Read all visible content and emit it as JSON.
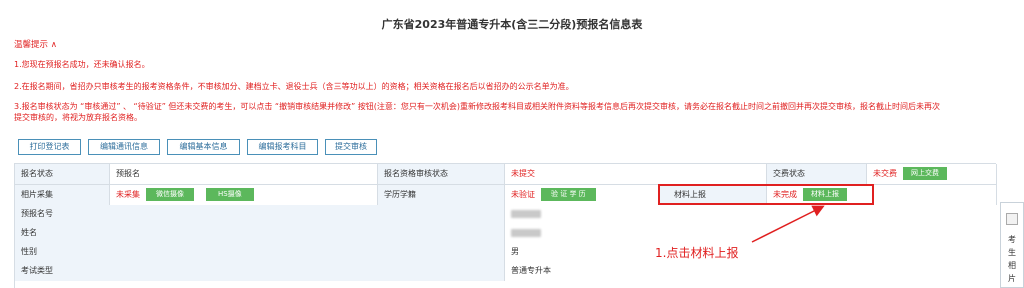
{
  "page": {
    "title": "广东省2023年普通专升本(含三二分段)预报名信息表",
    "tips_toggle": "温馨提示 ∧",
    "tips": [
      "1.您现在预报名成功，还未确认报名。",
      "2.在报名期间，省招办只审核考生的报考资格条件，不审核加分、建档立卡、退役士兵（含三等功以上）的资格；相关资格在报名后以省招办的公示名单为准。",
      "3.报名审核状态为 “审核通过” 、 “待验证” 但还未交费的考生，可以点击 “撤销审核结果并修改” 按钮(注意：您只有一次机会)重新修改报考科目或相关附件资料等报考信息后再次提交审核，请务必在报名截止时间之前撤回并再次提交审核，报名截止时间后未再次",
      "提交审核的，将视为放弃报名资格。"
    ]
  },
  "toolbar": {
    "print": "打印登记表",
    "edit_contact": "编辑通讯信息",
    "edit_basic": "编辑基本信息",
    "edit_subjects": "编辑报考科目",
    "submit": "提交审核"
  },
  "status_table": {
    "row1": {
      "status_label": "报名状态",
      "status_value": "预报名",
      "audit_label": "报名资格审核状态",
      "audit_value": "未提交",
      "fee_label": "交费状态",
      "fee_value": "未交费",
      "fee_button": "网上交费"
    },
    "row2": {
      "photo_label": "相片采集",
      "photo_value": "未采集",
      "wechat_button": "微信摄像",
      "hs_button": "HS摄像",
      "edu_label": "学历学籍",
      "edu_value": "未验证",
      "verify_button": "验 证 学 历",
      "material_label": "材料上报",
      "material_value": "未完成",
      "material_button": "材料上报"
    }
  },
  "info_rows": [
    {
      "label": "预报名号",
      "value": ""
    },
    {
      "label": "姓名",
      "value": ""
    },
    {
      "label": "性别",
      "value": "男"
    },
    {
      "label": "考试类型",
      "value": "普通专升本"
    }
  ],
  "photo": {
    "alt": "考生相片"
  },
  "annotation": {
    "text": "1.点击材料上报"
  },
  "colors": {
    "accent_red": "#e02020",
    "button_green": "#5cb85c",
    "label_bg": "#eef4fa",
    "outline_blue": "#4a90b8"
  }
}
